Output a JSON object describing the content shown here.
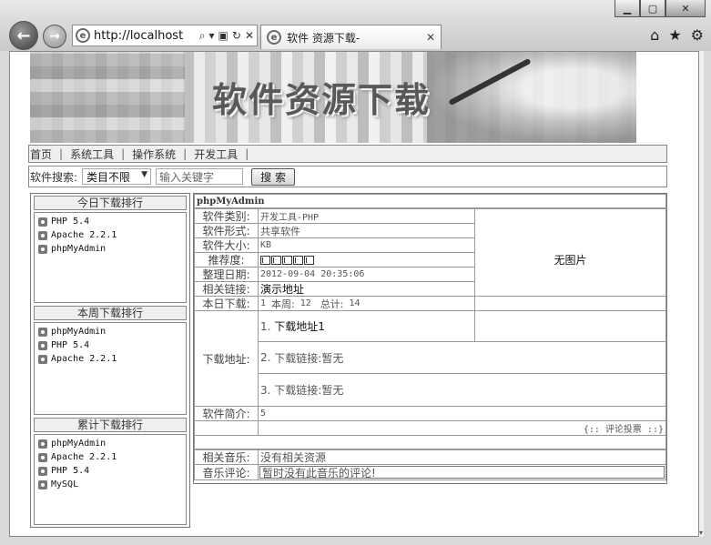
{
  "browser": {
    "url": "http://localhost",
    "tab_title": "软件 资源下载-",
    "close_glyph": "✕",
    "minimize_glyph": "▁",
    "maximize_glyph": "▢",
    "window_close_glyph": "✕"
  },
  "banner": {
    "title": "软件资源下载"
  },
  "nav": {
    "items": [
      "首页",
      "系统工具",
      "操作系统",
      "开发工具"
    ],
    "separator": "|"
  },
  "search": {
    "label": "软件搜索:",
    "category": "类目不限",
    "keyword_placeholder": "输入关键字",
    "button": "搜 索"
  },
  "ranks": {
    "today": {
      "title": "今日下载排行",
      "items": [
        "PHP 5.4",
        "Apache 2.2.1",
        "phpMyAdmin"
      ]
    },
    "week": {
      "title": "本周下载排行",
      "items": [
        "phpMyAdmin",
        "PHP 5.4",
        "Apache 2.2.1"
      ]
    },
    "total": {
      "title": "累计下载排行",
      "items": [
        "phpMyAdmin",
        "Apache 2.2.1",
        "PHP 5.4",
        "MySQL"
      ]
    }
  },
  "detail": {
    "name": "phpMyAdmin",
    "category_label": "软件类别:",
    "category": "开发工具-PHP",
    "form_label": "软件形式:",
    "form": "共享软件",
    "size_label": "软件大小:",
    "size": "KB",
    "rating_label": "推荐度:",
    "rating": 5,
    "date_label": "整理日期:",
    "date": "2012-09-04 20:35:06",
    "link_label": "相关链接:",
    "link": "演示地址",
    "today_label": "本日下载:",
    "today_count": "1",
    "week_label": "本周:",
    "week_count": "12",
    "total_label": "总计:",
    "total_count": "14",
    "no_image": "无图片",
    "download_label": "下载地址:",
    "downloads": [
      {
        "num": "1.",
        "text": "下载地址1"
      },
      {
        "num": "2.",
        "text": "下载链接:暂无"
      },
      {
        "num": "3.",
        "text": "下载链接:暂无"
      }
    ],
    "intro_label": "软件简介:",
    "intro": "5",
    "comment_vote": "{:: 评论投票 ::}",
    "music_label": "相关音乐:",
    "music": "没有相关资源",
    "music_comment_label": "音乐评论:",
    "music_comment": "暂时没有此音乐的评论!"
  }
}
